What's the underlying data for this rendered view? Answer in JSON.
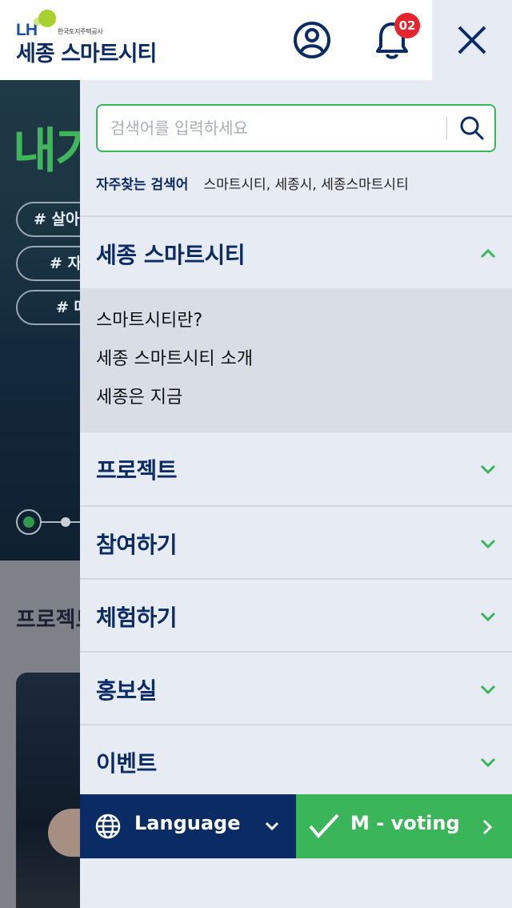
{
  "header": {
    "logo_lh": "LH",
    "logo_kor": "한국토지주택공사",
    "logo_name": "세종 스마트시티",
    "notification_count": "02"
  },
  "background": {
    "hero_title": "내가",
    "tags": [
      "# 살아 있",
      "# 자라",
      "# 떠"
    ],
    "section_title": "프로젝트"
  },
  "search": {
    "placeholder": "검색어를 입력하세요",
    "frequent_label": "자주찾는 검색어",
    "frequent_words": "스마트시티, 세종시, 세종스마트시티"
  },
  "menu": {
    "items": [
      {
        "label": "세종 스마트시티",
        "expanded": true
      },
      {
        "label": "프로젝트",
        "expanded": false
      },
      {
        "label": "참여하기",
        "expanded": false
      },
      {
        "label": "체험하기",
        "expanded": false
      },
      {
        "label": "홍보실",
        "expanded": false
      },
      {
        "label": "이벤트",
        "expanded": false
      }
    ],
    "submenu": [
      "스마트시티란?",
      "세종 스마트시티 소개",
      "세종은 지금"
    ]
  },
  "bottom": {
    "language_label": "Language",
    "voting_label": "M - voting"
  },
  "colors": {
    "navy": "#0a2b63",
    "green": "#3ab55a",
    "badge_red": "#e4252f",
    "drawer_bg": "#e7ebf3"
  }
}
